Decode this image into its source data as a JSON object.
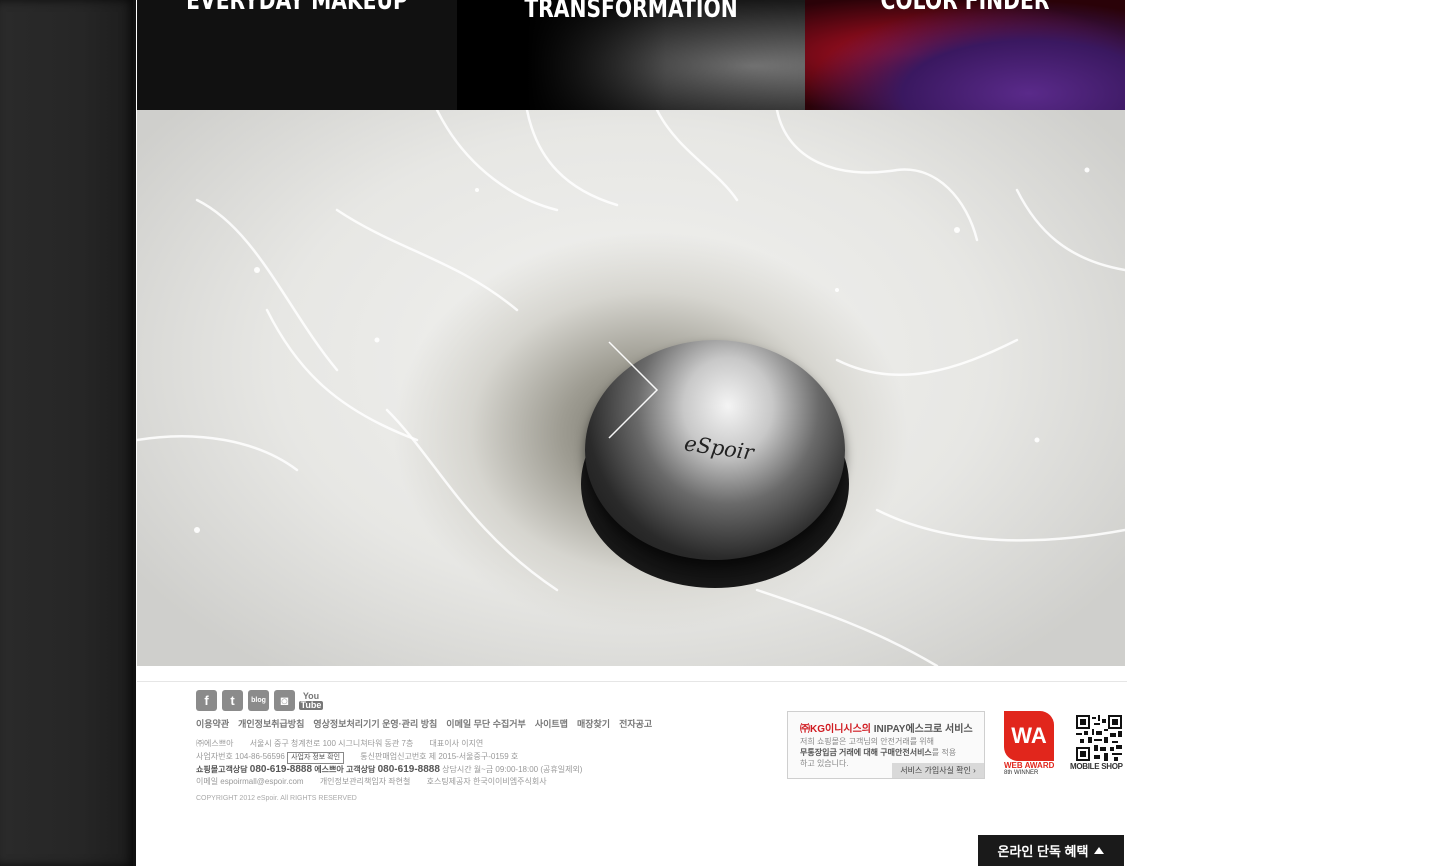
{
  "banners": [
    {
      "title": "EVERYDAY MAKEUP"
    },
    {
      "title": "TRANSFORMATION"
    },
    {
      "title": "COLOR FINDER"
    }
  ],
  "hero": {
    "product_logo": "eSpoir",
    "next_icon": "chevron-right-icon"
  },
  "footer": {
    "social": [
      {
        "name": "facebook",
        "glyph": "f"
      },
      {
        "name": "twitter",
        "glyph": "t"
      },
      {
        "name": "blog",
        "glyph": "blog"
      },
      {
        "name": "instagram",
        "glyph": "◙"
      },
      {
        "name": "youtube",
        "glyph_top": "You",
        "glyph_bottom": "Tube"
      }
    ],
    "links": [
      "이용약관",
      "개인정보취급방침",
      "영상정보처리기기 운영·관리 방침",
      "이메일 무단 수집거부",
      "사이트맵",
      "매장찾기",
      "전자공고"
    ],
    "info": {
      "line1_company": "㈜에스쁘아",
      "line1_address": "서울시 중구 청계천로 100 시그니쳐타워 동관 7층",
      "line1_ceo": "대표이사 이지연",
      "line2_bizno": "사업자번호 104-86-56596",
      "line2_bizbtn": "사업자 정보 확인",
      "line2_mailorder": "통신판매업신고번호 제 2015-서울중구-0159 호",
      "line3_shop_label": "쇼핑몰고객상담",
      "line3_shop_phone": "080-619-8888",
      "line3_cs_label": "에스쁘아 고객상담",
      "line3_cs_phone": "080-619-8888",
      "line3_hours": "상담시간 월~금 09:00-18:00 (공휴일제외)",
      "line4_email": "이메일 espoirmall@espoir.com",
      "line4_privacy": "개인정보관리책임자 좌현철",
      "line4_hosting": "호스팅제공자 한국이이비엠주식회사"
    },
    "copyright": "COPYRIGHT 2012 eSpoir. All RIGHTS RESERVED",
    "escrow": {
      "title_red": "㈜KG이니시스의",
      "title_rest": "INIPAY에스크로 서비스",
      "desc1": "저희 쇼핑몰은 고객님의 안전거래를 위해",
      "desc2_bold": "무통장입금 거래에 대해  구매안전서비스",
      "desc2_rest": "를 적용",
      "desc3": "하고 있습니다.",
      "button": "서비스 가입사실 확인 ›"
    },
    "webaward": {
      "mark": "WA",
      "text": "WEB AWARD",
      "sub": "8th WINNER"
    },
    "qr_label": "MOBILE SHOP",
    "benefit_button": "온라인 단독 혜택"
  }
}
